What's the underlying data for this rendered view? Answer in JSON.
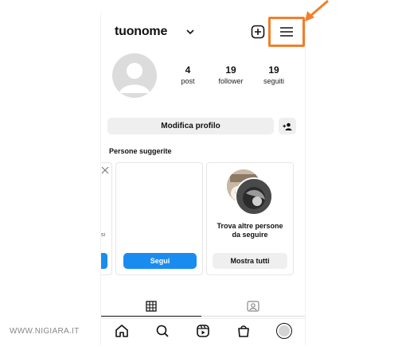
{
  "header": {
    "username": "tuonome",
    "icons": [
      "chevron-down-icon",
      "plus-square-icon",
      "hamburger-menu-icon"
    ]
  },
  "annotation": {
    "color": "#f07f2a",
    "icon": "arrow-icon"
  },
  "profile": {
    "stats": [
      {
        "value": "4",
        "label": "post"
      },
      {
        "value": "19",
        "label": "follower"
      },
      {
        "value": "19",
        "label": "seguiti"
      }
    ],
    "edit_label": "Modifica profilo",
    "discover_icon": "add-person-icon"
  },
  "suggested": {
    "heading": "Persone suggerite",
    "partial_card_text": "si",
    "follow_label": "Segui",
    "find_more_text": "Trova altre persone da seguire",
    "show_all_label": "Mostra tutti"
  },
  "tabs": [
    "grid-icon",
    "tagged-icon"
  ],
  "bottom_nav": [
    "home-icon",
    "search-icon",
    "reels-icon",
    "shop-icon",
    "profile-avatar"
  ],
  "watermark": "WWW.NIGIARA.IT",
  "colors": {
    "accent": "#1a8cf0",
    "highlight": "#f07f2a",
    "button_gray": "#efefef"
  }
}
